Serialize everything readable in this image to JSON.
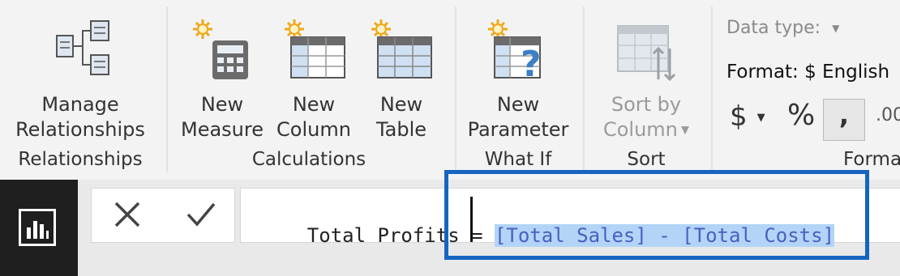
{
  "ribbon": {
    "groups": {
      "relationships": "Relationships",
      "calculations": "Calculations",
      "what_if": "What If",
      "sort": "Sort",
      "formatting": "Forma"
    },
    "buttons": {
      "manage_relationships": [
        "Manage",
        "Relationships"
      ],
      "new_measure": [
        "New",
        "Measure"
      ],
      "new_column": [
        "New",
        "Column"
      ],
      "new_table": [
        "New",
        "Table"
      ],
      "new_parameter": [
        "New",
        "Parameter"
      ],
      "sort_by_column": [
        "Sort by",
        "Column"
      ]
    },
    "format": {
      "data_type_label": "Data type:",
      "format_label": "Format: $ English",
      "currency_symbol": "$",
      "percent_symbol": "%",
      "comma_symbol": ",",
      "decimal_symbol": ".00"
    }
  },
  "formula_bar": {
    "prefix": "Total Profits = ",
    "selected": "[Total Sales] - [Total Costs]"
  },
  "colors": {
    "highlight_box": "#1565c0",
    "selection": "#b3d4f7",
    "formula_blue": "#4a5fc1"
  }
}
